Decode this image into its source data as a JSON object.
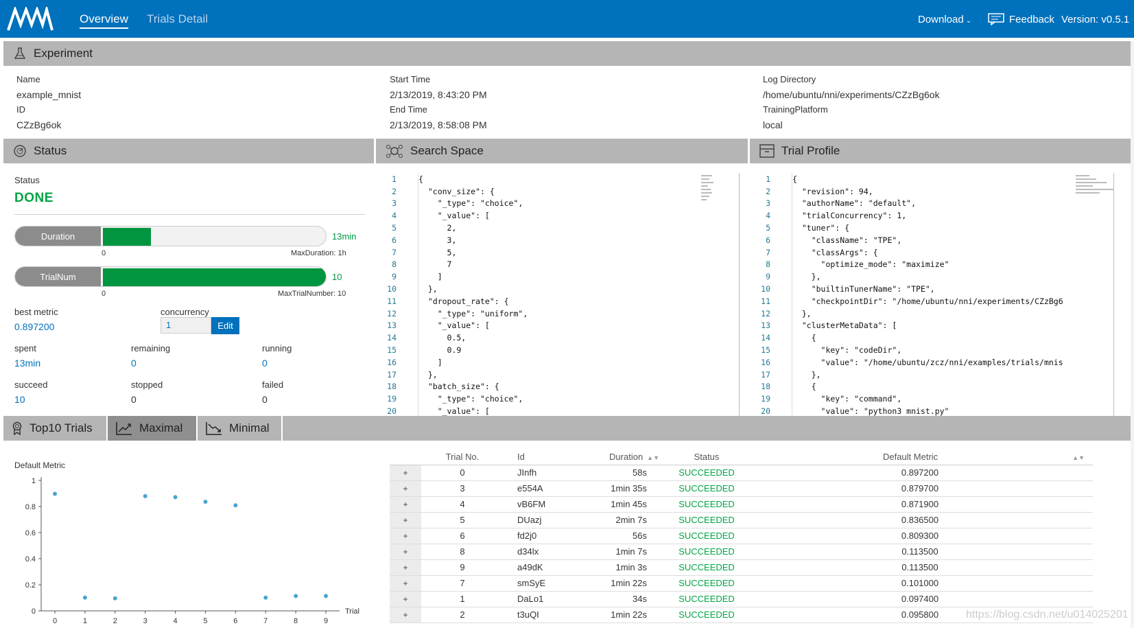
{
  "nav": {
    "overview": "Overview",
    "trials_detail": "Trials Detail",
    "download": "Download",
    "feedback": "Feedback",
    "version": "Version: v0.5.1"
  },
  "experiment": {
    "header": "Experiment",
    "name_label": "Name",
    "name": "example_mnist",
    "id_label": "ID",
    "id": "CZzBg6ok",
    "start_label": "Start Time",
    "start": "2/13/2019, 8:43:20 PM",
    "end_label": "End Time",
    "end": "2/13/2019, 8:58:08 PM",
    "logdir_label": "Log Directory",
    "logdir": "/home/ubuntu/nni/experiments/CZzBg6ok",
    "platform_label": "TrainingPlatform",
    "platform": "local"
  },
  "status": {
    "header": "Status",
    "status_label": "Status",
    "status": "DONE",
    "duration_label": "Duration",
    "duration_value": "13min",
    "duration_fraction": 0.2167,
    "duration_min": "0",
    "duration_max": "MaxDuration: 1h",
    "trialnum_label": "TrialNum",
    "trialnum_value": "10",
    "trialnum_fraction": 1.0,
    "trialnum_min": "0",
    "trialnum_max": "MaxTrialNumber: 10",
    "best_metric_label": "best metric",
    "best_metric": "0.897200",
    "concurrency_label": "concurrency",
    "concurrency": "1",
    "edit_label": "Edit",
    "spent_label": "spent",
    "spent": "13min",
    "remaining_label": "remaining",
    "remaining": "0",
    "running_label": "running",
    "running": "0",
    "succeed_label": "succeed",
    "succeed": "10",
    "stopped_label": "stopped",
    "stopped": "0",
    "failed_label": "failed",
    "failed": "0"
  },
  "search_space": {
    "header": "Search Space",
    "lines": [
      "{",
      "  \"conv_size\": {",
      "    \"_type\": \"choice\",",
      "    \"_value\": [",
      "      2,",
      "      3,",
      "      5,",
      "      7",
      "    ]",
      "  },",
      "  \"dropout_rate\": {",
      "    \"_type\": \"uniform\",",
      "    \"_value\": [",
      "      0.5,",
      "      0.9",
      "    ]",
      "  },",
      "  \"batch_size\": {",
      "    \"_type\": \"choice\",",
      "    \"_value\": ["
    ]
  },
  "trial_profile": {
    "header": "Trial Profile",
    "lines": [
      "{",
      "  \"revision\": 94,",
      "  \"authorName\": \"default\",",
      "  \"trialConcurrency\": 1,",
      "  \"tuner\": {",
      "    \"className\": \"TPE\",",
      "    \"classArgs\": {",
      "      \"optimize_mode\": \"maximize\"",
      "    },",
      "    \"builtinTunerName\": \"TPE\",",
      "    \"checkpointDir\": \"/home/ubuntu/nni/experiments/CZzBg6",
      "  },",
      "  \"clusterMetaData\": [",
      "    {",
      "      \"key\": \"codeDir\",",
      "      \"value\": \"/home/ubuntu/zcz/nni/examples/trials/mnis",
      "    },",
      "    {",
      "      \"key\": \"command\",",
      "      \"value\": \"python3 mnist.py\""
    ]
  },
  "tabs": {
    "top10": "Top10 Trials",
    "maximal": "Maximal",
    "minimal": "Minimal"
  },
  "chart_data": {
    "type": "scatter",
    "title": "Default Metric",
    "xlabel": "Trial",
    "ylabel": "",
    "x": [
      0,
      1,
      2,
      3,
      4,
      5,
      6,
      7,
      8,
      9
    ],
    "y": [
      0.8972,
      0.1015,
      0.0958,
      0.8797,
      0.8719,
      0.8365,
      0.8093,
      0.101,
      0.1135,
      0.1135
    ],
    "xlim": [
      0,
      9
    ],
    "ylim": [
      0,
      1
    ],
    "xticks": [
      "0",
      "1",
      "2",
      "3",
      "4",
      "5",
      "6",
      "7",
      "8",
      "9"
    ],
    "yticks": [
      "0",
      "0.2",
      "0.4",
      "0.6",
      "0.8",
      "1"
    ],
    "point_color": "#4aa3cf"
  },
  "table": {
    "headers": [
      "Trial No.",
      "Id",
      "Duration",
      "Status",
      "Default Metric"
    ],
    "expand_label": "+",
    "rows": [
      {
        "no": "0",
        "id": "JInfh",
        "duration": "58s",
        "status": "SUCCEEDED",
        "metric": "0.897200"
      },
      {
        "no": "3",
        "id": "e554A",
        "duration": "1min 35s",
        "status": "SUCCEEDED",
        "metric": "0.879700"
      },
      {
        "no": "4",
        "id": "vB6FM",
        "duration": "1min 45s",
        "status": "SUCCEEDED",
        "metric": "0.871900"
      },
      {
        "no": "5",
        "id": "DUazj",
        "duration": "2min 7s",
        "status": "SUCCEEDED",
        "metric": "0.836500"
      },
      {
        "no": "6",
        "id": "fd2j0",
        "duration": "56s",
        "status": "SUCCEEDED",
        "metric": "0.809300"
      },
      {
        "no": "8",
        "id": "d34lx",
        "duration": "1min 7s",
        "status": "SUCCEEDED",
        "metric": "0.113500"
      },
      {
        "no": "9",
        "id": "a49dK",
        "duration": "1min 3s",
        "status": "SUCCEEDED",
        "metric": "0.113500"
      },
      {
        "no": "7",
        "id": "smSyE",
        "duration": "1min 22s",
        "status": "SUCCEEDED",
        "metric": "0.101000"
      },
      {
        "no": "1",
        "id": "DaLo1",
        "duration": "34s",
        "status": "SUCCEEDED",
        "metric": "0.097400"
      },
      {
        "no": "2",
        "id": "t3uQI",
        "duration": "1min 22s",
        "status": "SUCCEEDED",
        "metric": "0.095800"
      }
    ]
  },
  "watermark": "https://blog.csdn.net/u014025201",
  "colors": {
    "brand": "#0071bc",
    "success": "#00a445",
    "bar": "#00963f",
    "header_bg": "#b5b5b5"
  }
}
